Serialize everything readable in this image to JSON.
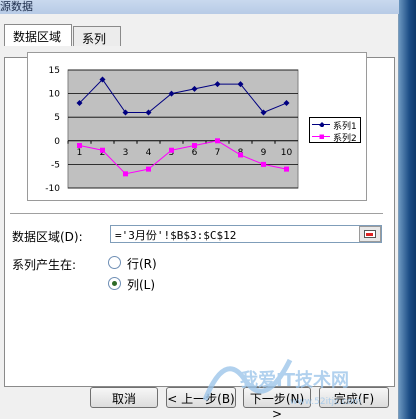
{
  "window": {
    "title": "源数据"
  },
  "tabs": [
    {
      "label": "数据区域",
      "active": true
    },
    {
      "label": "系列",
      "active": false
    }
  ],
  "chart_data": {
    "type": "line",
    "categories": [
      "1",
      "2",
      "3",
      "4",
      "5",
      "6",
      "7",
      "8",
      "9",
      "10"
    ],
    "series": [
      {
        "name": "系列1",
        "color": "#000080",
        "marker": "diamond",
        "values": [
          8,
          13,
          6,
          6,
          10,
          11,
          12,
          12,
          6,
          8
        ]
      },
      {
        "name": "系列2",
        "color": "#ff00ff",
        "marker": "square",
        "values": [
          -1,
          -2,
          -7,
          -6,
          -2,
          -1,
          0,
          -3,
          -5,
          -6
        ]
      }
    ],
    "ylim": [
      -10,
      15
    ],
    "yticks": [
      "15",
      "10",
      "5",
      "0",
      "-5",
      "-10"
    ],
    "ytick_values": [
      15,
      10,
      5,
      0,
      -5,
      -10
    ],
    "plot_background": "#c0c0c0",
    "grid": true,
    "legend": "right"
  },
  "form": {
    "range_label": "数据区域(D):",
    "range_value": "='3月份'!$B$3:$C$12",
    "series_in_label": "系列产生在:",
    "options": [
      {
        "label": "行(R)",
        "checked": false
      },
      {
        "label": "列(L)",
        "checked": true
      }
    ]
  },
  "buttons": {
    "cancel": "取消",
    "back": "< 上一步(B)",
    "next": "下一步(N) >",
    "finish": "完成(F)"
  },
  "watermark": {
    "text": "我爱IT技术网",
    "url": "www.52itjc.com"
  }
}
